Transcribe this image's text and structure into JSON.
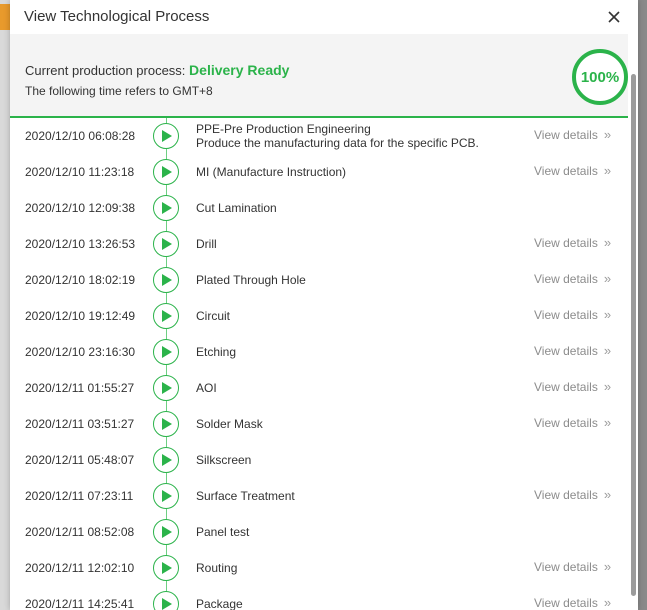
{
  "modal": {
    "title": "View Technological Process"
  },
  "status": {
    "label": "Current production process:",
    "value": "Delivery Ready",
    "timezone_note": "The following time refers to GMT+8",
    "progress_percent": 100,
    "progress_label": "100%"
  },
  "view_details_label": "View details",
  "steps": [
    {
      "time": "2020/12/10 06:08:28",
      "name": "PPE-Pre Production Engineering",
      "desc": "Produce the manufacturing data for the specific PCB.",
      "has_details": true
    },
    {
      "time": "2020/12/10 11:23:18",
      "name": "MI (Manufacture Instruction)",
      "has_details": true
    },
    {
      "time": "2020/12/10 12:09:38",
      "name": "Cut Lamination",
      "has_details": false
    },
    {
      "time": "2020/12/10 13:26:53",
      "name": "Drill",
      "has_details": true
    },
    {
      "time": "2020/12/10 18:02:19",
      "name": "Plated Through Hole",
      "has_details": true
    },
    {
      "time": "2020/12/10 19:12:49",
      "name": "Circuit",
      "has_details": true
    },
    {
      "time": "2020/12/10 23:16:30",
      "name": "Etching",
      "has_details": true
    },
    {
      "time": "2020/12/11 01:55:27",
      "name": "AOI",
      "has_details": true
    },
    {
      "time": "2020/12/11 03:51:27",
      "name": "Solder Mask",
      "has_details": true
    },
    {
      "time": "2020/12/11 05:48:07",
      "name": "Silkscreen",
      "has_details": false
    },
    {
      "time": "2020/12/11 07:23:11",
      "name": "Surface Treatment",
      "has_details": true
    },
    {
      "time": "2020/12/11 08:52:08",
      "name": "Panel test",
      "has_details": false
    },
    {
      "time": "2020/12/11 12:02:10",
      "name": "Routing",
      "has_details": true
    },
    {
      "time": "2020/12/11 14:25:41",
      "name": "Package",
      "has_details": true
    }
  ],
  "colors": {
    "accent": "#2bb34a",
    "text": "#333333",
    "muted": "#8c8c8c"
  },
  "icons": {
    "close": "close-icon",
    "step": "play-icon",
    "details": "double-chevron-right-icon"
  }
}
